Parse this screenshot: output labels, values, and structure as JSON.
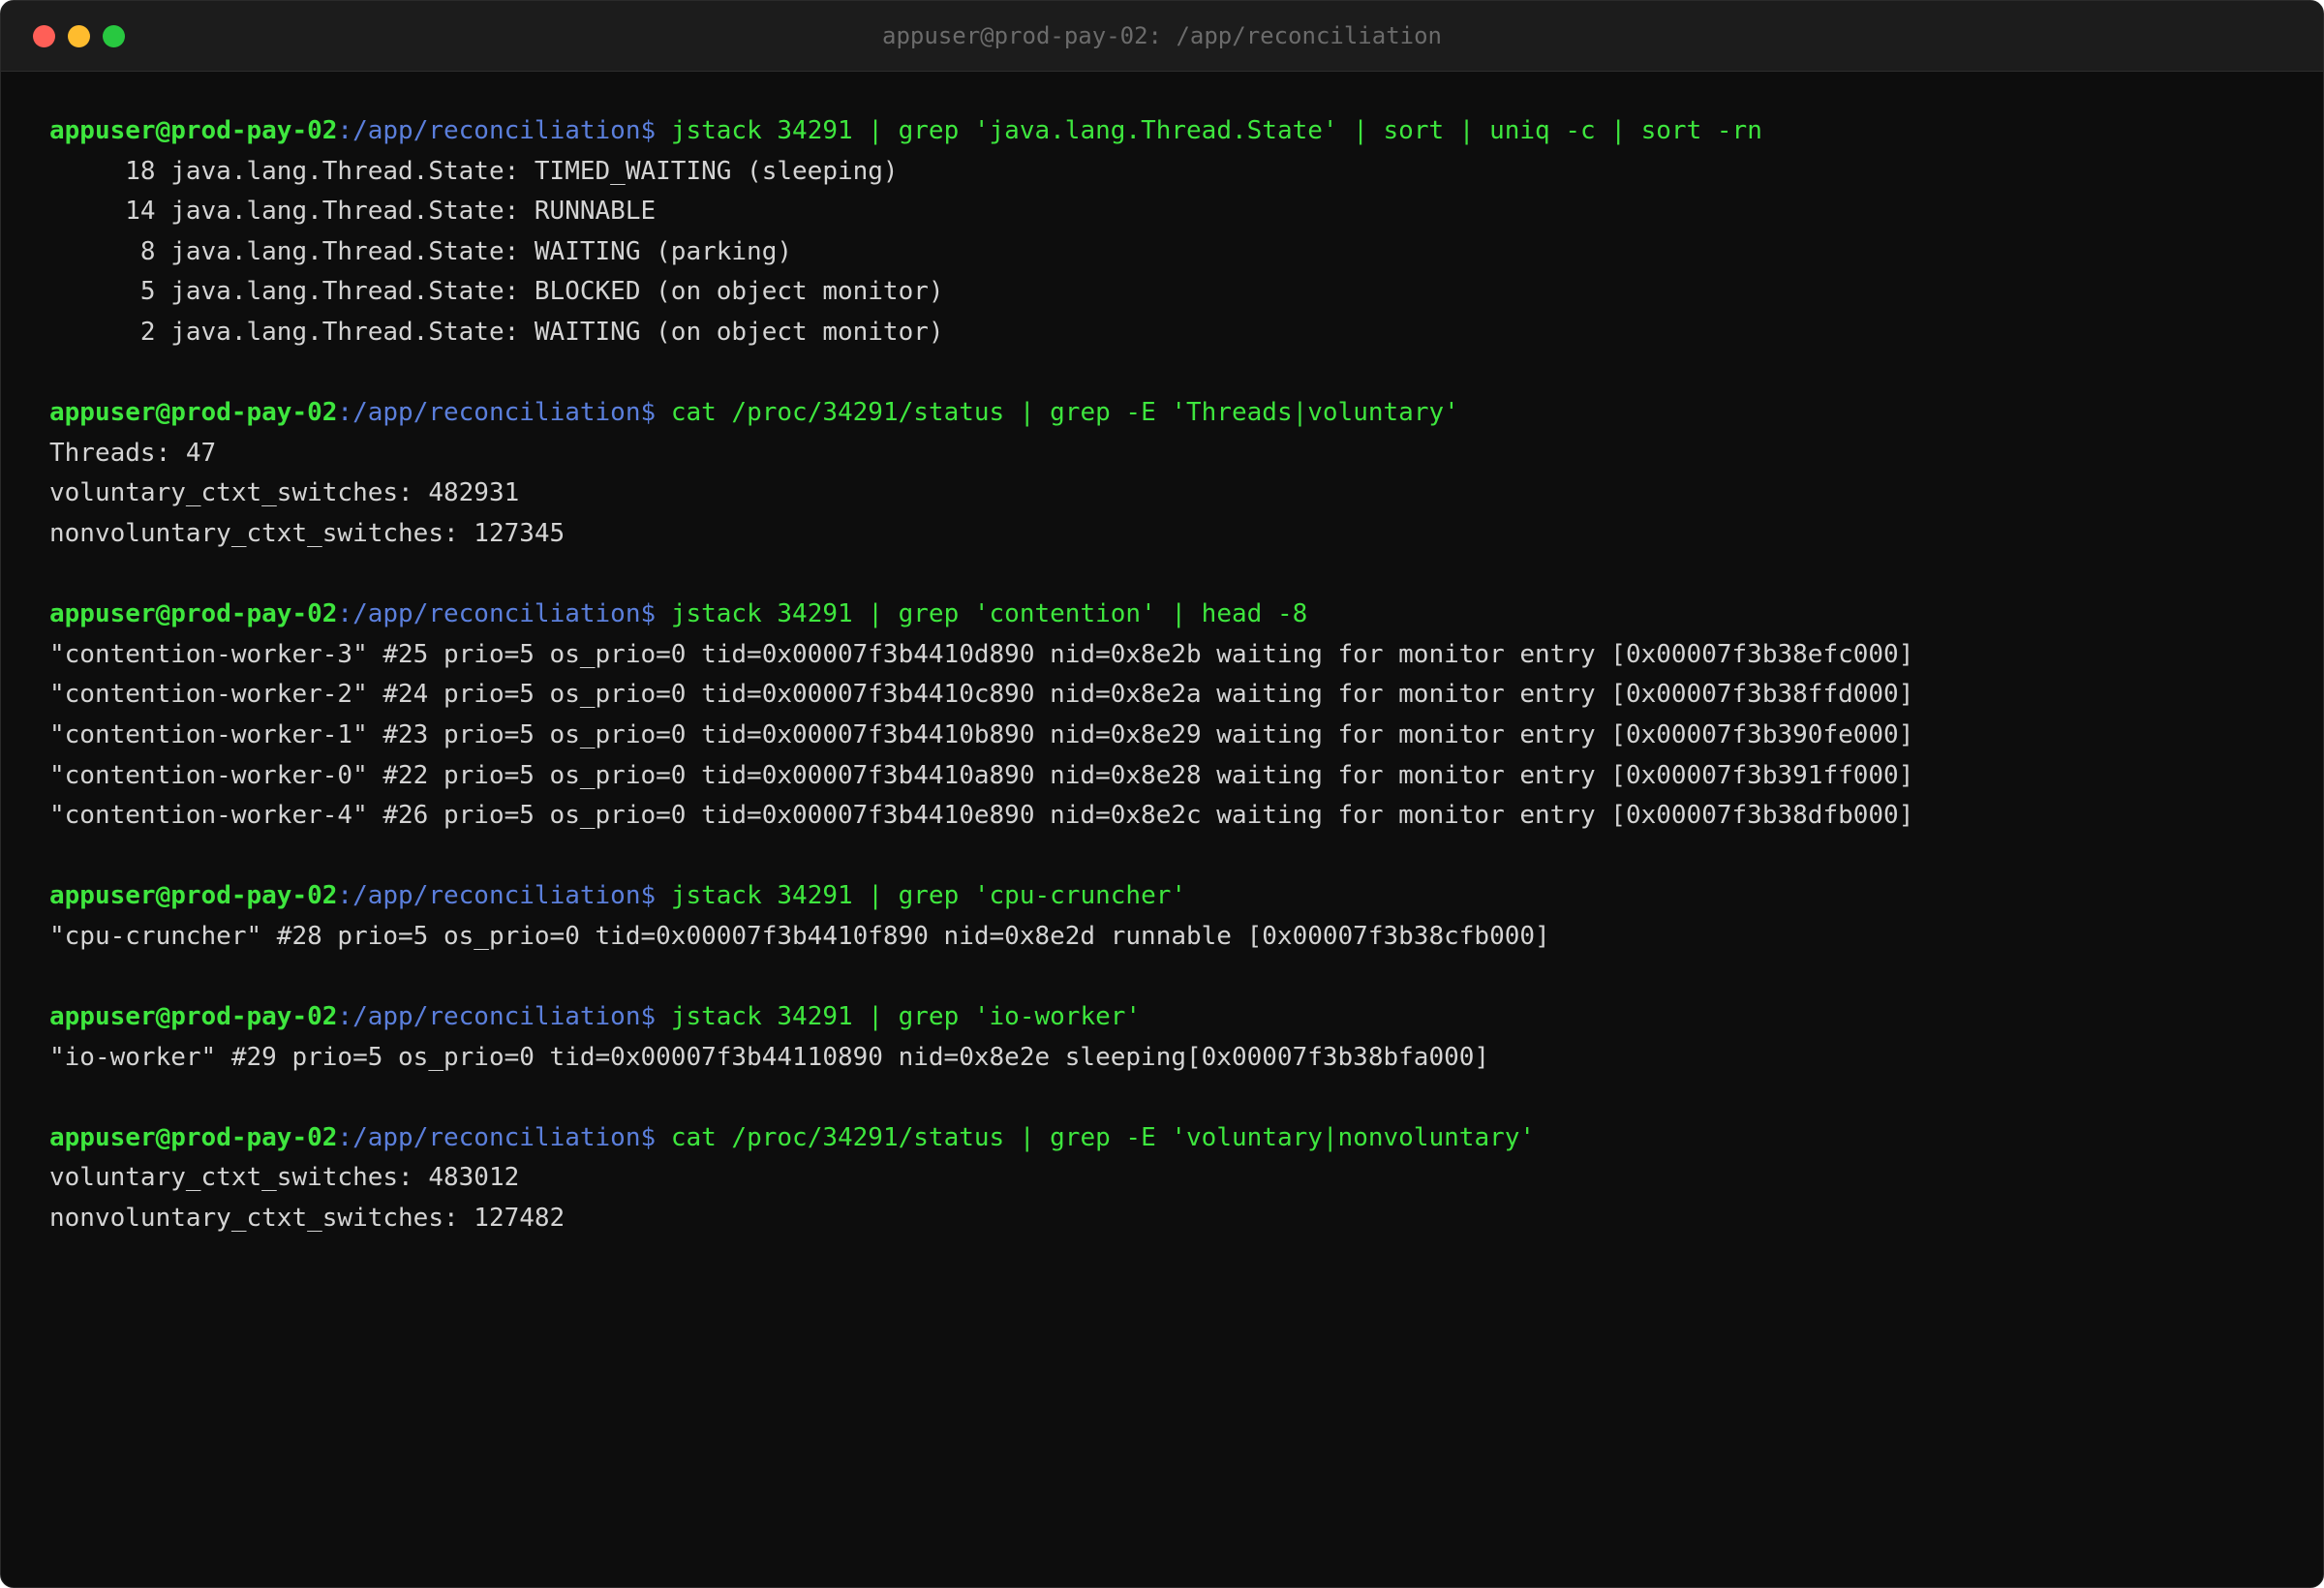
{
  "window": {
    "title": "appuser@prod-pay-02: /app/reconciliation",
    "traffic_lights": {
      "close_color": "#ff5f57",
      "minimize_color": "#febc2e",
      "maximize_color": "#28c840"
    }
  },
  "prompt": {
    "user": "appuser",
    "at": "@",
    "host": "prod-pay-02",
    "path": ":/app/reconciliation",
    "symbol": "$"
  },
  "blocks": [
    {
      "command": "jstack 34291 | grep 'java.lang.Thread.State' | sort | uniq -c | sort -rn",
      "output": [
        "     18 java.lang.Thread.State: TIMED_WAITING (sleeping)",
        "     14 java.lang.Thread.State: RUNNABLE",
        "      8 java.lang.Thread.State: WAITING (parking)",
        "      5 java.lang.Thread.State: BLOCKED (on object monitor)",
        "      2 java.lang.Thread.State: WAITING (on object monitor)"
      ]
    },
    {
      "command": "cat /proc/34291/status | grep -E 'Threads|voluntary'",
      "output": [
        "Threads: 47",
        "voluntary_ctxt_switches: 482931",
        "nonvoluntary_ctxt_switches: 127345"
      ]
    },
    {
      "command": "jstack 34291 | grep 'contention' | head -8",
      "output": [
        "\"contention-worker-3\" #25 prio=5 os_prio=0 tid=0x00007f3b4410d890 nid=0x8e2b waiting for monitor entry [0x00007f3b38efc000]",
        "\"contention-worker-2\" #24 prio=5 os_prio=0 tid=0x00007f3b4410c890 nid=0x8e2a waiting for monitor entry [0x00007f3b38ffd000]",
        "\"contention-worker-1\" #23 prio=5 os_prio=0 tid=0x00007f3b4410b890 nid=0x8e29 waiting for monitor entry [0x00007f3b390fe000]",
        "\"contention-worker-0\" #22 prio=5 os_prio=0 tid=0x00007f3b4410a890 nid=0x8e28 waiting for monitor entry [0x00007f3b391ff000]",
        "\"contention-worker-4\" #26 prio=5 os_prio=0 tid=0x00007f3b4410e890 nid=0x8e2c waiting for monitor entry [0x00007f3b38dfb000]"
      ]
    },
    {
      "command": "jstack 34291 | grep 'cpu-cruncher'",
      "output": [
        "\"cpu-cruncher\" #28 prio=5 os_prio=0 tid=0x00007f3b4410f890 nid=0x8e2d runnable [0x00007f3b38cfb000]"
      ]
    },
    {
      "command": "jstack 34291 | grep 'io-worker'",
      "output": [
        "\"io-worker\" #29 prio=5 os_prio=0 tid=0x00007f3b44110890 nid=0x8e2e sleeping[0x00007f3b38bfa000]"
      ]
    },
    {
      "command": "cat /proc/34291/status | grep -E 'voluntary|nonvoluntary'",
      "output": [
        "voluntary_ctxt_switches: 483012",
        "nonvoluntary_ctxt_switches: 127482"
      ]
    }
  ]
}
